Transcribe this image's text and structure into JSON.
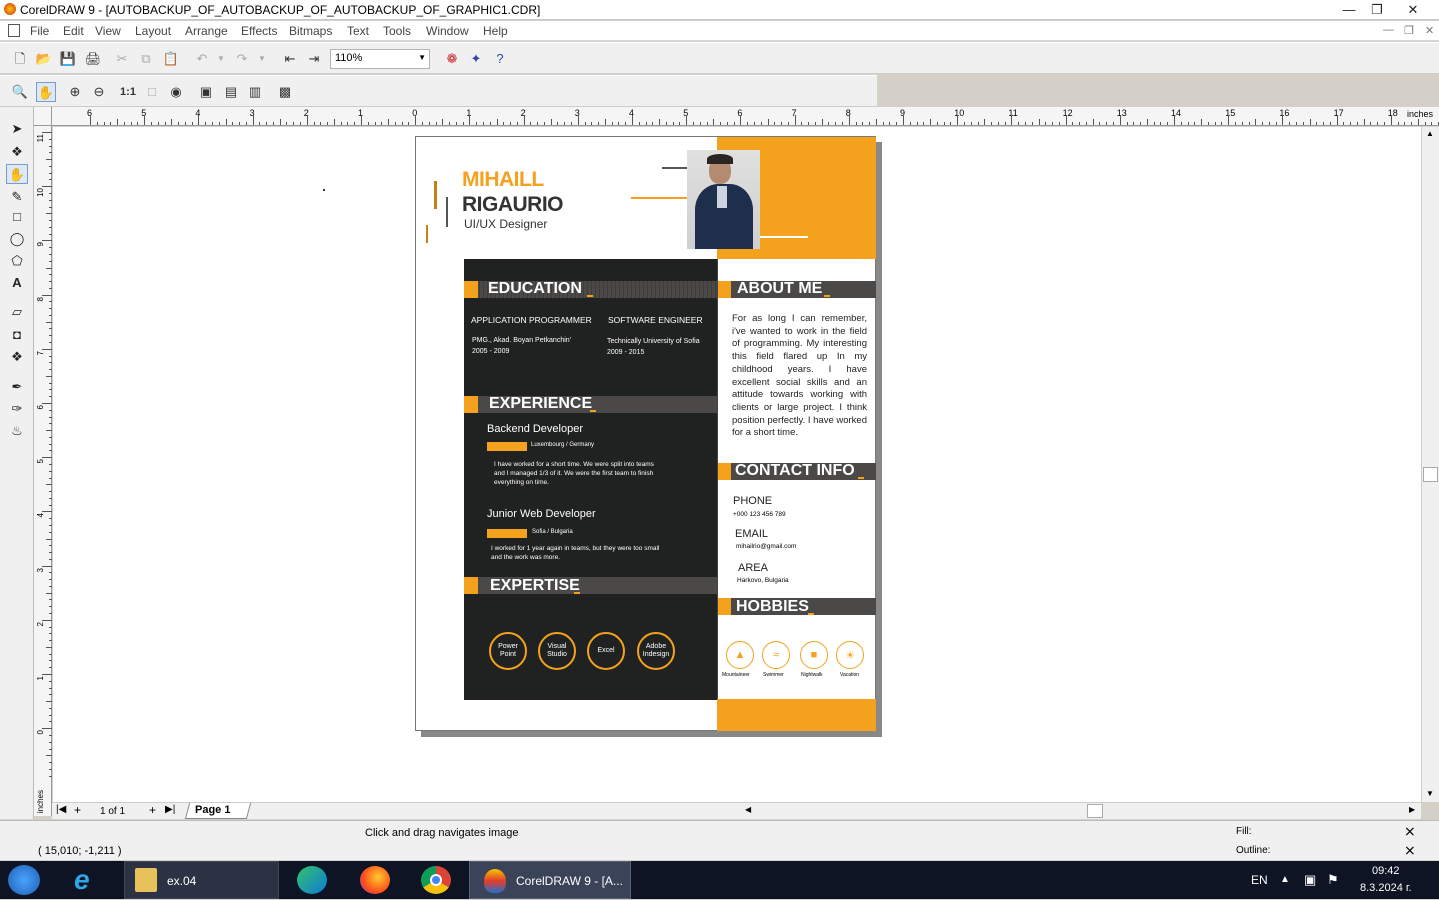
{
  "window": {
    "title": "CorelDRAW 9 - [AUTOBACKUP_OF_AUTOBACKUP_OF_AUTOBACKUP_OF_GRAPHIC1.CDR]"
  },
  "menu": [
    "File",
    "Edit",
    "View",
    "Layout",
    "Arrange",
    "Effects",
    "Bitmaps",
    "Text",
    "Tools",
    "Window",
    "Help"
  ],
  "toolbar": {
    "zoom": "110%"
  },
  "ruler": {
    "units": "inches",
    "top_ticks": [
      "6",
      "5",
      "4",
      "3",
      "2",
      "1",
      "0",
      "1",
      "2",
      "3",
      "4",
      "5",
      "6",
      "7",
      "8",
      "9",
      "10",
      "11",
      "12",
      "13",
      "14",
      "15",
      "16",
      "17",
      "18"
    ],
    "left_ticks": [
      "11",
      "10",
      "9",
      "8",
      "7",
      "6",
      "5",
      "4",
      "3",
      "2",
      "1",
      "0"
    ]
  },
  "pagebar": {
    "count": "1 of 1",
    "page_tab": "Page 1"
  },
  "status": {
    "hint": "Click and drag navigates image",
    "coords": "( 15,010; -1,211 )",
    "fill_label": "Fill:",
    "outline_label": "Outline:"
  },
  "taskbar": {
    "explorer": "ex.04",
    "corel": "CorelDRAW 9 - [A...",
    "lang": "EN",
    "time": "09:42",
    "date": "8.3.2024 г."
  },
  "resume": {
    "first_name": "MIHAILL",
    "last_name": "RIGAURIO",
    "role": "UI/UX Designer",
    "education_title": "EDUCATION",
    "education": [
      {
        "title": "APPLICATION PROGRAMMER",
        "school": "PMG., Akad. Boyan Petkanchin'",
        "years": "2005 - 2009"
      },
      {
        "title": "SOFTWARE ENGINEER",
        "school": "Technically University of Sofia",
        "years": "2009 - 2015"
      }
    ],
    "experience_title": "EXPERIENCE",
    "experience": [
      {
        "title": "Backend Developer",
        "place": "Luxembourg / Germany",
        "desc1": "I have worked for a short time. We were split into teams",
        "desc2": "and I managed 1/3 of it. We were the first team to finish",
        "desc3": "everything on time."
      },
      {
        "title": "Junior Web Developer",
        "place": "Sofia / Bulgaria",
        "desc1": "I worked for 1 year again in teams, but they were too small",
        "desc2": "and the work was more."
      }
    ],
    "expertise_title": "EXPERTISE",
    "skills": [
      "Power Point",
      "Visual Studio",
      "Excel",
      "Adobe Indesign"
    ],
    "about_title": "ABOUT ME",
    "about_text": "For as long I can remember, i've wanted to work in the field of programming. My interesting this field flared up In my childhood years. I have excellent social skills and an attitude towards working with clients or large project. I think position perfectly. I have worked for a short time.",
    "contact_title": "CONTACT INFO",
    "contact": [
      {
        "label": "PHONE",
        "value": "+000 123 456 789"
      },
      {
        "label": "EMAIL",
        "value": "mihailrio@gmail.com"
      },
      {
        "label": "AREA",
        "value": "Harkovo, Bulgaria"
      }
    ],
    "hobbies_title": "HOBBIES",
    "hobbies": [
      "Mountaineer",
      "Swimmer",
      "Nightwalk",
      "Vacation"
    ],
    "accent_color": "#f4a11d",
    "dark_color": "#202221"
  }
}
